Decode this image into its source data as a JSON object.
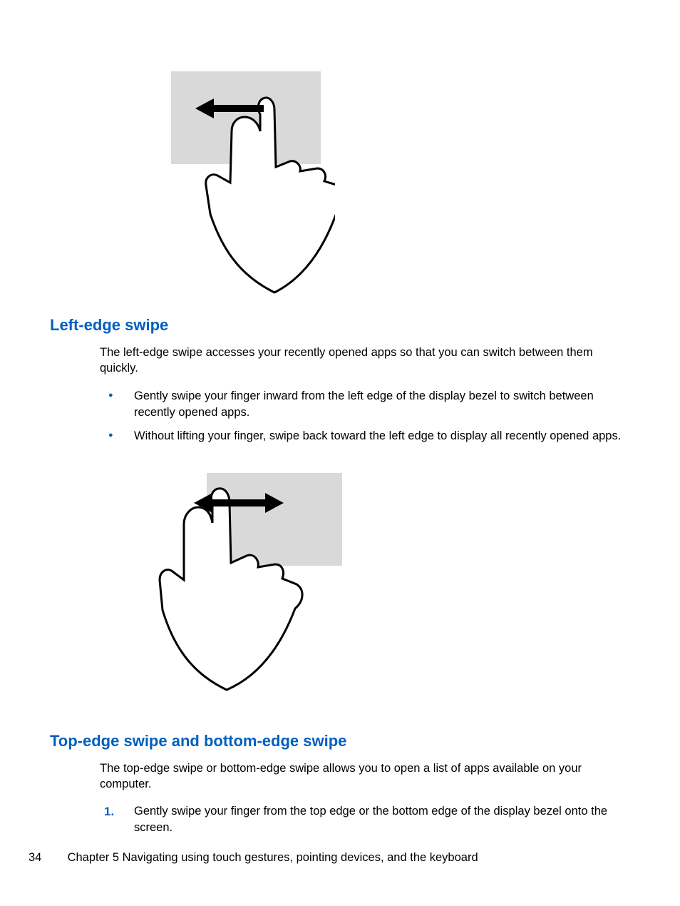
{
  "section1": {
    "heading": "Left-edge swipe",
    "intro": "The left-edge swipe accesses your recently opened apps so that you can switch between them quickly.",
    "bullets": [
      "Gently swipe your finger inward from the left edge of the display bezel to switch between recently opened apps.",
      "Without lifting your finger, swipe back toward the left edge to display all recently opened apps."
    ]
  },
  "section2": {
    "heading": "Top-edge swipe and bottom-edge swipe",
    "intro": "The top-edge swipe or bottom-edge swipe allows you to open a list of apps available on your computer.",
    "steps": [
      "Gently swipe your finger from the top edge or the bottom edge of the display bezel onto the screen."
    ]
  },
  "footer": {
    "page_number": "34",
    "chapter_text": "Chapter 5   Navigating using touch gestures, pointing devices, and the keyboard"
  }
}
